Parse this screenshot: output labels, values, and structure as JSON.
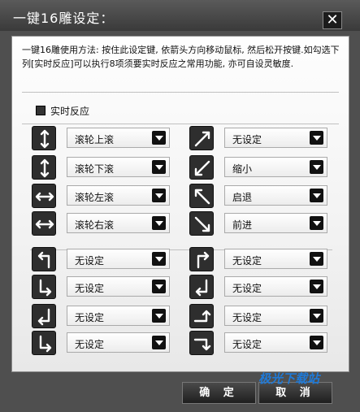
{
  "window": {
    "title": "一键16雕设定：",
    "close_label": "✕"
  },
  "description": "一键16雕使用方法: 按住此设定键, 依箭头方向移动鼠标, 然后松开按键.如勾选下列[实时反应]可以执行8项须要实时反应之常用功能, 亦可自设灵敏度.",
  "realtime": {
    "label": "实时反应",
    "checked": false
  },
  "options": [
    {
      "icon": "arrow-up-down-icon",
      "value": "滚轮上滚"
    },
    {
      "icon": "arrow-diag-up-right-icon",
      "value": "无设定"
    },
    {
      "icon": "arrow-down-up-icon",
      "value": "滚轮下滚"
    },
    {
      "icon": "arrow-diag-down-left-icon",
      "value": "缩小"
    },
    {
      "icon": "arrow-left-right-icon",
      "value": "滚轮左滚"
    },
    {
      "icon": "arrow-diag-up-left-icon",
      "value": "启退"
    },
    {
      "icon": "arrow-right-left-icon",
      "value": "滚轮右滚"
    },
    {
      "icon": "arrow-diag-down-right-icon",
      "value": "前进"
    },
    {
      "icon": "arrow-up-left-turn-icon",
      "value": "无设定"
    },
    {
      "icon": "arrow-up-right-turn-icon",
      "value": "无设定"
    },
    {
      "icon": "arrow-right-down-turn-icon",
      "value": "无设定"
    },
    {
      "icon": "arrow-down-left-turn-icon",
      "value": "无设定"
    },
    {
      "icon": "arrow-down-left-hook-icon",
      "value": "无设定"
    },
    {
      "icon": "arrow-right-up-turn-icon",
      "value": "无设定"
    },
    {
      "icon": "arrow-down-right-turn-icon",
      "value": "无设定"
    },
    {
      "icon": "arrow-right-down-hook-icon",
      "value": "无设定"
    }
  ],
  "buttons": {
    "ok": "确 定",
    "cancel": "取 消"
  },
  "watermark": "极光下载站",
  "colors": {
    "window_bg": "#4f4f4f",
    "panel_bg": "#f4f4f4",
    "accent": "#111111"
  }
}
